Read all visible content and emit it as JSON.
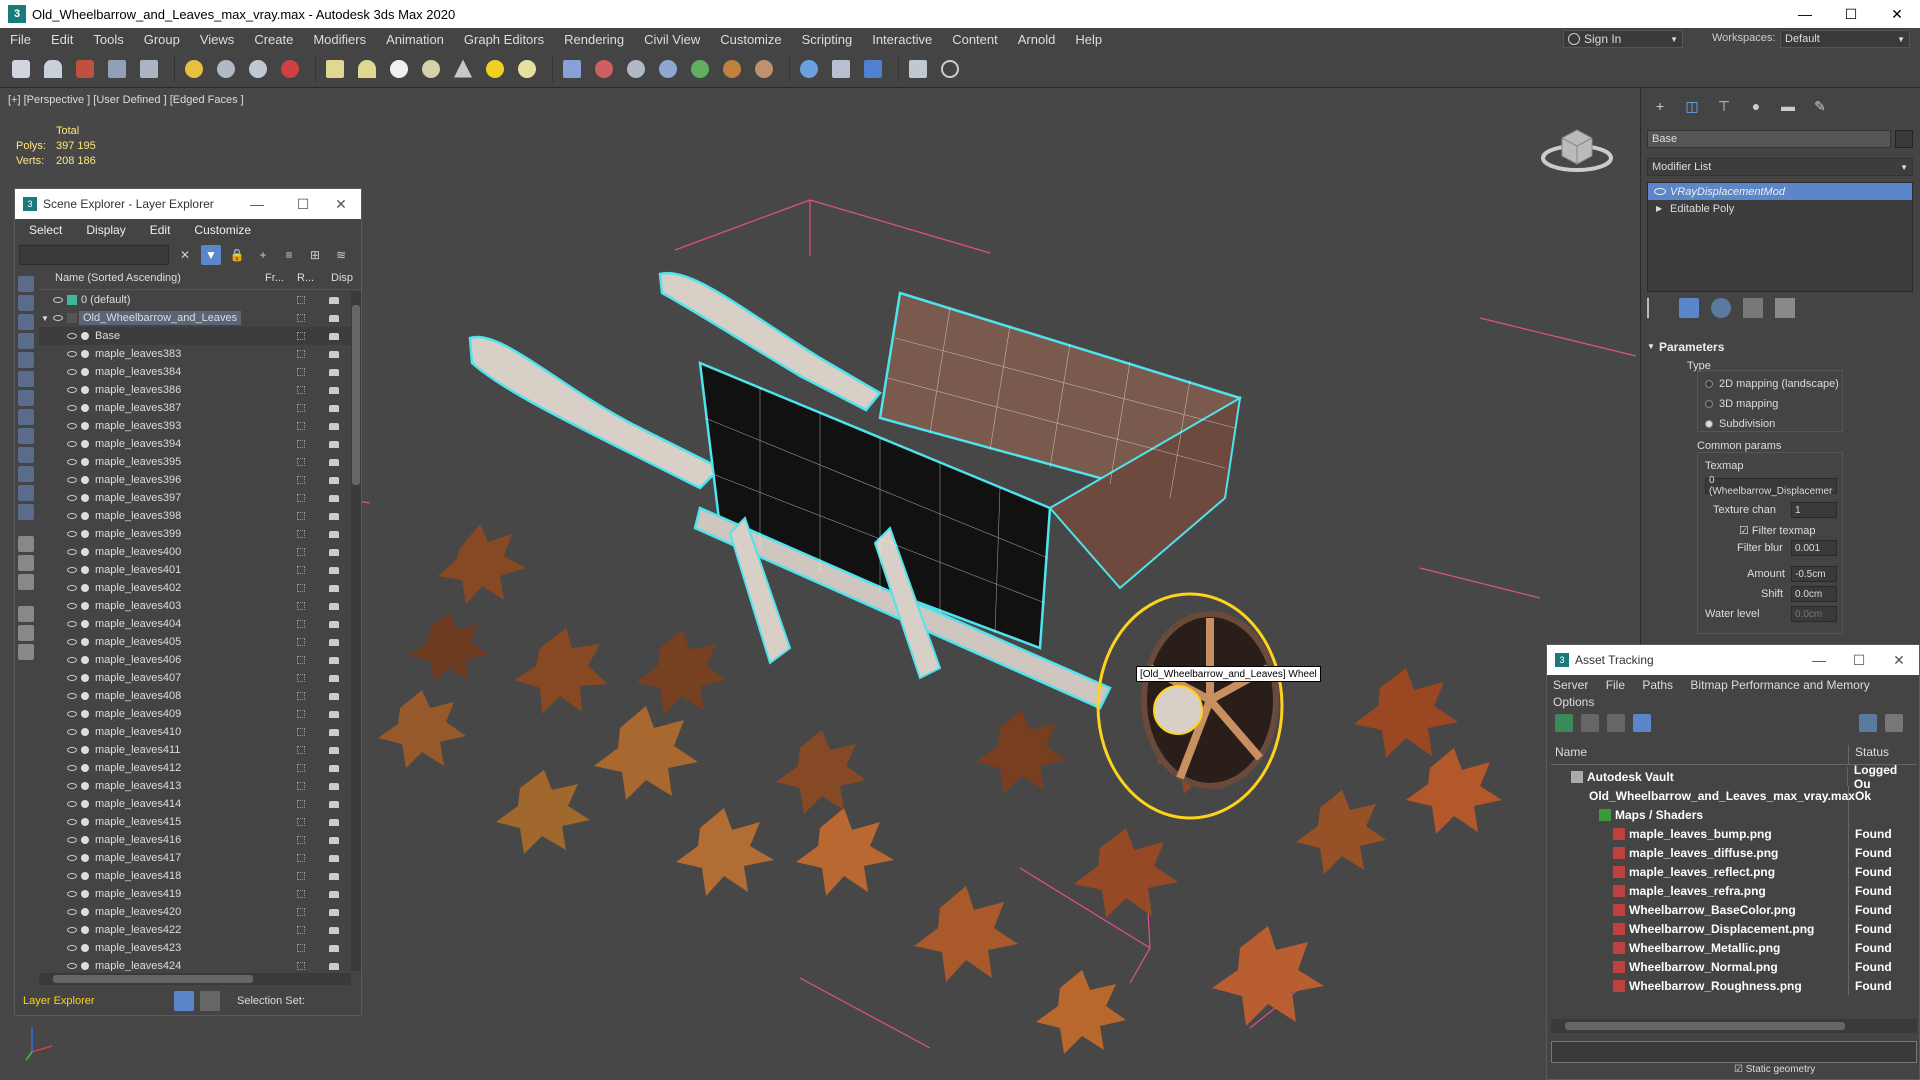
{
  "window": {
    "title": "Old_Wheelbarrow_and_Leaves_max_vray.max - Autodesk 3ds Max 2020"
  },
  "menu": [
    "File",
    "Edit",
    "Tools",
    "Group",
    "Views",
    "Create",
    "Modifiers",
    "Animation",
    "Graph Editors",
    "Rendering",
    "Civil View",
    "Customize",
    "Scripting",
    "Interactive",
    "Content",
    "Arnold",
    "Help"
  ],
  "signin": "Sign In",
  "workspaces": {
    "label": "Workspaces:",
    "value": "Default"
  },
  "viewport": {
    "label": "[+] [Perspective ] [User Defined ] [Edged Faces ]",
    "stats": {
      "total": "Total",
      "polys_label": "Polys:",
      "polys": "397 195",
      "verts_label": "Verts:",
      "verts": "208 186"
    },
    "tooltip": "[Old_Wheelbarrow_and_Leaves] Wheel"
  },
  "scene_explorer": {
    "title": "Scene Explorer - Layer Explorer",
    "menu": [
      "Select",
      "Display",
      "Edit",
      "Customize"
    ],
    "columns": {
      "name": "Name (Sorted Ascending)",
      "frozen": "Fr...",
      "render": "R...",
      "display": "Disp"
    },
    "rows": [
      {
        "name": "0 (default)",
        "level": 1,
        "type": "layer"
      },
      {
        "name": "Old_Wheelbarrow_and_Leaves",
        "level": 1,
        "type": "layer-selected"
      },
      {
        "name": "Base",
        "level": 2,
        "type": "base"
      },
      {
        "name": "maple_leaves383",
        "level": 2
      },
      {
        "name": "maple_leaves384",
        "level": 2
      },
      {
        "name": "maple_leaves386",
        "level": 2
      },
      {
        "name": "maple_leaves387",
        "level": 2
      },
      {
        "name": "maple_leaves393",
        "level": 2
      },
      {
        "name": "maple_leaves394",
        "level": 2
      },
      {
        "name": "maple_leaves395",
        "level": 2
      },
      {
        "name": "maple_leaves396",
        "level": 2
      },
      {
        "name": "maple_leaves397",
        "level": 2
      },
      {
        "name": "maple_leaves398",
        "level": 2
      },
      {
        "name": "maple_leaves399",
        "level": 2
      },
      {
        "name": "maple_leaves400",
        "level": 2
      },
      {
        "name": "maple_leaves401",
        "level": 2
      },
      {
        "name": "maple_leaves402",
        "level": 2
      },
      {
        "name": "maple_leaves403",
        "level": 2
      },
      {
        "name": "maple_leaves404",
        "level": 2
      },
      {
        "name": "maple_leaves405",
        "level": 2
      },
      {
        "name": "maple_leaves406",
        "level": 2
      },
      {
        "name": "maple_leaves407",
        "level": 2
      },
      {
        "name": "maple_leaves408",
        "level": 2
      },
      {
        "name": "maple_leaves409",
        "level": 2
      },
      {
        "name": "maple_leaves410",
        "level": 2
      },
      {
        "name": "maple_leaves411",
        "level": 2
      },
      {
        "name": "maple_leaves412",
        "level": 2
      },
      {
        "name": "maple_leaves413",
        "level": 2
      },
      {
        "name": "maple_leaves414",
        "level": 2
      },
      {
        "name": "maple_leaves415",
        "level": 2
      },
      {
        "name": "maple_leaves416",
        "level": 2
      },
      {
        "name": "maple_leaves417",
        "level": 2
      },
      {
        "name": "maple_leaves418",
        "level": 2
      },
      {
        "name": "maple_leaves419",
        "level": 2
      },
      {
        "name": "maple_leaves420",
        "level": 2
      },
      {
        "name": "maple_leaves422",
        "level": 2
      },
      {
        "name": "maple_leaves423",
        "level": 2
      },
      {
        "name": "maple_leaves424",
        "level": 2
      }
    ],
    "footer": {
      "explorer": "Layer Explorer",
      "selection_set": "Selection Set:"
    }
  },
  "command_panel": {
    "object_name": "Base",
    "modifier_list": "Modifier List",
    "stack": [
      {
        "name": "VRayDisplacementMod",
        "selected": true
      },
      {
        "name": "Editable Poly",
        "selected": false
      }
    ],
    "rollout": "Parameters",
    "type_label": "Type",
    "types": [
      {
        "label": "2D mapping (landscape)",
        "on": false
      },
      {
        "label": "3D mapping",
        "on": false
      },
      {
        "label": "Subdivision",
        "on": true
      }
    ],
    "common_params": "Common params",
    "texmap_label": "Texmap",
    "texmap_value": "0 (Wheelbarrow_Displacemer",
    "texture_chan_label": "Texture chan",
    "texture_chan": "1",
    "filter_texmap": "Filter texmap",
    "filter_blur_label": "Filter blur",
    "filter_blur": "0.001",
    "amount_label": "Amount",
    "amount": "-0.5cm",
    "shift_label": "Shift",
    "shift": "0.0cm",
    "water_level_label": "Water level",
    "water_level": "0.0cm"
  },
  "asset_tracking": {
    "title": "Asset Tracking",
    "menu": [
      "Server",
      "File",
      "Paths",
      "Bitmap Performance and Memory",
      "Options"
    ],
    "columns": {
      "name": "Name",
      "status": "Status"
    },
    "rows": [
      {
        "name": "Autodesk Vault",
        "status": "Logged Ou",
        "level": 0
      },
      {
        "name": "Old_Wheelbarrow_and_Leaves_max_vray.max",
        "status": "Ok",
        "level": 1
      },
      {
        "name": "Maps / Shaders",
        "status": "",
        "level": 2
      },
      {
        "name": "maple_leaves_bump.png",
        "status": "Found",
        "level": 3
      },
      {
        "name": "maple_leaves_diffuse.png",
        "status": "Found",
        "level": 3
      },
      {
        "name": "maple_leaves_reflect.png",
        "status": "Found",
        "level": 3
      },
      {
        "name": "maple_leaves_refra.png",
        "status": "Found",
        "level": 3
      },
      {
        "name": "Wheelbarrow_BaseColor.png",
        "status": "Found",
        "level": 3
      },
      {
        "name": "Wheelbarrow_Displacement.png",
        "status": "Found",
        "level": 3
      },
      {
        "name": "Wheelbarrow_Metallic.png",
        "status": "Found",
        "level": 3
      },
      {
        "name": "Wheelbarrow_Normal.png",
        "status": "Found",
        "level": 3
      },
      {
        "name": "Wheelbarrow_Roughness.png",
        "status": "Found",
        "level": 3
      }
    ]
  },
  "static_geometry": "Static geometry",
  "colors": {
    "selection": "#5b86c9",
    "highlight_yellow": "#ffd21c",
    "wire_cyan": "#4fe3ee"
  }
}
